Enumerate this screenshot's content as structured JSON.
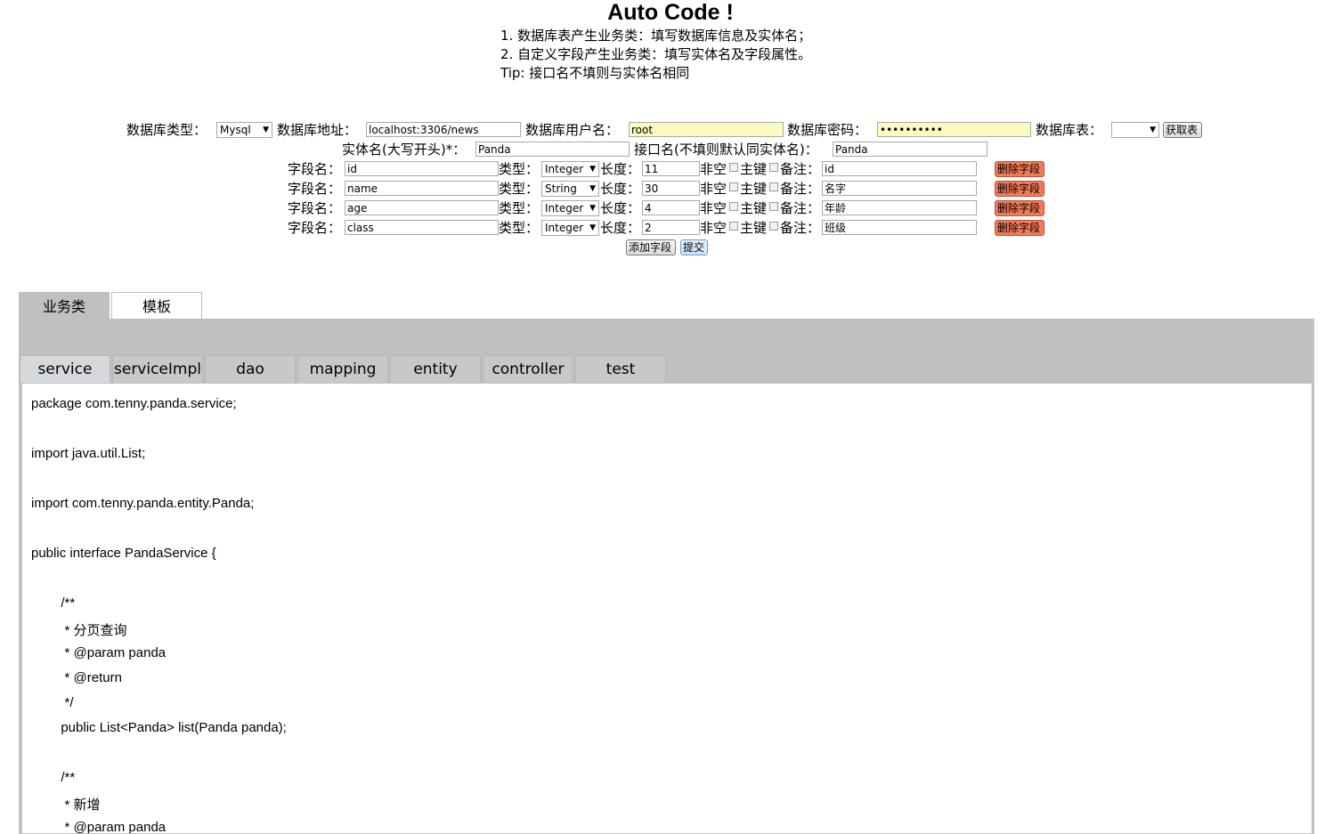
{
  "header": {
    "title": "Auto Code !",
    "desc1": "1. 数据库表产生业务类：填写数据库信息及实体名；",
    "desc2": "2. 自定义字段产生业务类：填写实体名及字段属性。",
    "tip": "Tip: 接口名不填则与实体名相同"
  },
  "db": {
    "type_label": "数据库类型：",
    "type_value": "Mysql",
    "addr_label": "数据库地址：",
    "addr_value": "localhost:3306/news",
    "user_label": "数据库用户名：",
    "user_value": "root",
    "pwd_label": "数据库密码：",
    "pwd_value": "••••••••••",
    "table_label": "数据库表：",
    "table_value": "",
    "fetch_button": "获取表"
  },
  "entity": {
    "name_label": "实体名(大写开头)*：",
    "name_value": "Panda",
    "iface_label": "接口名(不填则默认同实体名)：",
    "iface_value": "Panda"
  },
  "field_labels": {
    "name": "字段名：",
    "type": "类型：",
    "length": "长度：",
    "notnull": "非空",
    "pk": "主键",
    "remark": "备注：",
    "delete": "删除字段"
  },
  "fields": [
    {
      "name": "id",
      "type": "Integer",
      "length": "11",
      "remark": "id"
    },
    {
      "name": "name",
      "type": "String",
      "length": "30",
      "remark": "名字"
    },
    {
      "name": "age",
      "type": "Integer",
      "length": "4",
      "remark": "年龄"
    },
    {
      "name": "class",
      "type": "Integer",
      "length": "2",
      "remark": "班级"
    }
  ],
  "actions": {
    "add_field": "添加字段",
    "submit": "提交"
  },
  "top_tabs": [
    "业务类",
    "模板"
  ],
  "sub_tabs": [
    "service",
    "serviceImpl",
    "dao",
    "mapping",
    "entity",
    "controller",
    "test"
  ],
  "code_lines": [
    "package com.tenny.panda.service;",
    "",
    "import java.util.List;",
    "",
    "import com.tenny.panda.entity.Panda;",
    "",
    "public interface PandaService {",
    "",
    "        /**",
    "         * 分页查询",
    "         * @param panda",
    "         * @return",
    "         */",
    "        public List<Panda> list(Panda panda);",
    "",
    "        /**",
    "         * 新增",
    "         * @param panda"
  ]
}
